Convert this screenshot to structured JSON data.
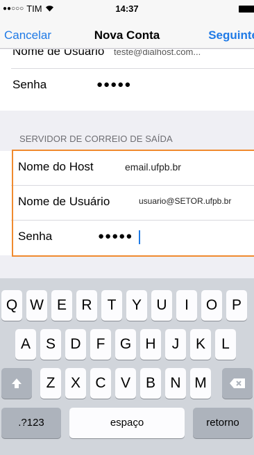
{
  "status_bar": {
    "carrier": "TIM",
    "signal": "●●○○○",
    "wifi": "wifi",
    "time": "14:37"
  },
  "nav": {
    "cancel": "Cancelar",
    "title": "Nova Conta",
    "next": "Seguinte"
  },
  "incoming": {
    "clipped_label": "Nome de Usuário",
    "clipped_value": "teste@dialhost.com...",
    "password_label": "Senha",
    "password_value": "●●●●●"
  },
  "outgoing": {
    "header": "SERVIDOR DE CORREIO DE SAÍDA",
    "host_label": "Nome do Host",
    "host_value": "email.ufpb.br",
    "user_label": "Nome de Usuário",
    "user_value": "usuario@SETOR.ufpb.br",
    "password_label": "Senha",
    "password_value": "●●●●●"
  },
  "keyboard": {
    "row1": [
      "Q",
      "W",
      "E",
      "R",
      "T",
      "Y",
      "U",
      "I",
      "O",
      "P"
    ],
    "row2": [
      "A",
      "S",
      "D",
      "F",
      "G",
      "H",
      "J",
      "K",
      "L"
    ],
    "row3": [
      "Z",
      "X",
      "C",
      "V",
      "B",
      "N",
      "M"
    ],
    "numbers_key": ".?123",
    "space_key": "espaço",
    "return_key": "retorno"
  }
}
